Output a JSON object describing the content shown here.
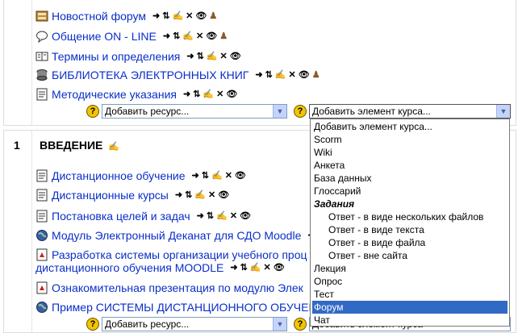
{
  "section0": {
    "items": [
      {
        "icon": "forum-icon",
        "label": "Новостной форум",
        "person": true
      },
      {
        "icon": "chat-icon",
        "label": "Общение ON - LINE",
        "person": true
      },
      {
        "icon": "glossary-icon",
        "label": "Термины и определения",
        "person": false
      },
      {
        "icon": "database-icon",
        "label": "БИБЛИОТЕКА ЭЛЕКТРОННЫХ КНИГ",
        "person": true
      },
      {
        "icon": "page-icon",
        "label": "Методические указания",
        "person": false
      }
    ],
    "add_resource": "Добавить ресурс...",
    "add_activity": "Добавить элемент курса..."
  },
  "section1": {
    "number": "1",
    "title": "ВВЕДЕНИЕ",
    "items": [
      {
        "icon": "page-icon",
        "label": "Дистанционное обучение"
      },
      {
        "icon": "page-icon",
        "label": "Дистанционные курсы"
      },
      {
        "icon": "page-icon",
        "label": "Постановка целей и задач"
      },
      {
        "icon": "globe-icon",
        "label": "Модуль Электронный Деканат для СДО Moodle"
      },
      {
        "icon": "pdf-icon",
        "label": "Разработка системы организации учебного проц",
        "label2": "дистанционного обучения MOODLE"
      },
      {
        "icon": "pdf-icon",
        "label": "Ознакомительная презентация по модулю Элек"
      },
      {
        "icon": "globe-icon",
        "label": "Пример СИСТЕМЫ ДИСТАНЦИОННОГО ОБУЧЕН"
      }
    ],
    "add_resource": "Добавить ресурс...",
    "add_activity_partial": "Добавить элемент курса"
  },
  "help_symbol": "?",
  "dropdown": {
    "options": [
      {
        "label": "Добавить элемент курса...",
        "kind": "normal"
      },
      {
        "label": "Scorm",
        "kind": "normal"
      },
      {
        "label": "Wiki",
        "kind": "normal"
      },
      {
        "label": "Анкета",
        "kind": "normal"
      },
      {
        "label": "База данных",
        "kind": "normal"
      },
      {
        "label": "Глоссарий",
        "kind": "normal"
      },
      {
        "label": "Задания",
        "kind": "group"
      },
      {
        "label": "Ответ - в виде нескольких файлов",
        "kind": "sub"
      },
      {
        "label": "Ответ - в виде текста",
        "kind": "sub"
      },
      {
        "label": "Ответ - в виде файла",
        "kind": "sub"
      },
      {
        "label": "Ответ - вне сайта",
        "kind": "sub"
      },
      {
        "label": "Лекция",
        "kind": "normal"
      },
      {
        "label": "Опрос",
        "kind": "normal"
      },
      {
        "label": "Тест",
        "kind": "normal"
      },
      {
        "label": "Форум",
        "kind": "selected"
      },
      {
        "label": "Чат",
        "kind": "normal"
      }
    ]
  }
}
